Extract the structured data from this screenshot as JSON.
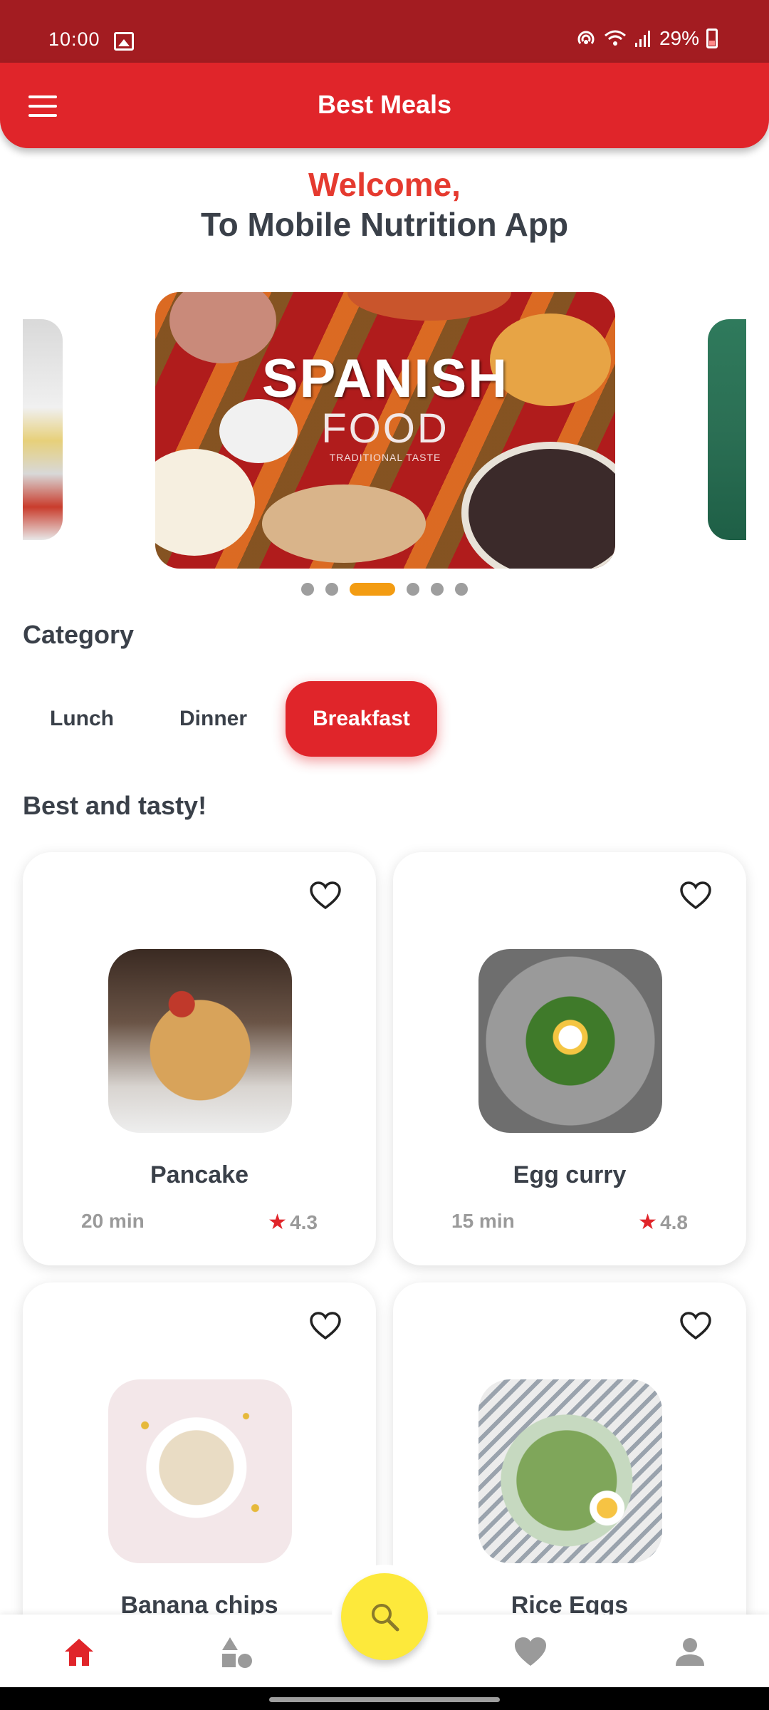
{
  "status_bar": {
    "time": "10:00",
    "battery": "29%"
  },
  "app_bar": {
    "title": "Best Meals"
  },
  "welcome": {
    "line1": "Welcome,",
    "line2": "To Mobile Nutrition App"
  },
  "carousel": {
    "slide_title": "SPANISH",
    "slide_subtitle": "FOOD",
    "slide_tagline": "TRADITIONAL TASTE",
    "dot_count": 6,
    "active_dot": 3
  },
  "category": {
    "heading": "Category",
    "items": [
      {
        "label": "Lunch",
        "selected": false
      },
      {
        "label": "Dinner",
        "selected": false
      },
      {
        "label": "Breakfast",
        "selected": true
      }
    ]
  },
  "best": {
    "heading": "Best and tasty!",
    "items": [
      {
        "name": "Pancake",
        "time": "20 min",
        "rating": "4.3"
      },
      {
        "name": "Egg curry",
        "time": "15 min",
        "rating": "4.8"
      },
      {
        "name": "Banana chips",
        "time": "",
        "rating": ""
      },
      {
        "name": "Rice Eggs",
        "time": "",
        "rating": ""
      }
    ]
  },
  "bottom_nav": {
    "items": [
      {
        "icon": "home-icon",
        "active": true
      },
      {
        "icon": "shapes-icon",
        "active": false
      },
      {
        "icon": "heart-icon",
        "active": false
      },
      {
        "icon": "person-icon",
        "active": false
      }
    ],
    "fab_icon": "search-icon"
  },
  "colors": {
    "primary": "#e0252a",
    "status_bar": "#a31c21",
    "accent_orange": "#f39c12",
    "fab": "#fde93b",
    "text_dark": "#3a4049",
    "text_muted": "#9a9a9a"
  }
}
